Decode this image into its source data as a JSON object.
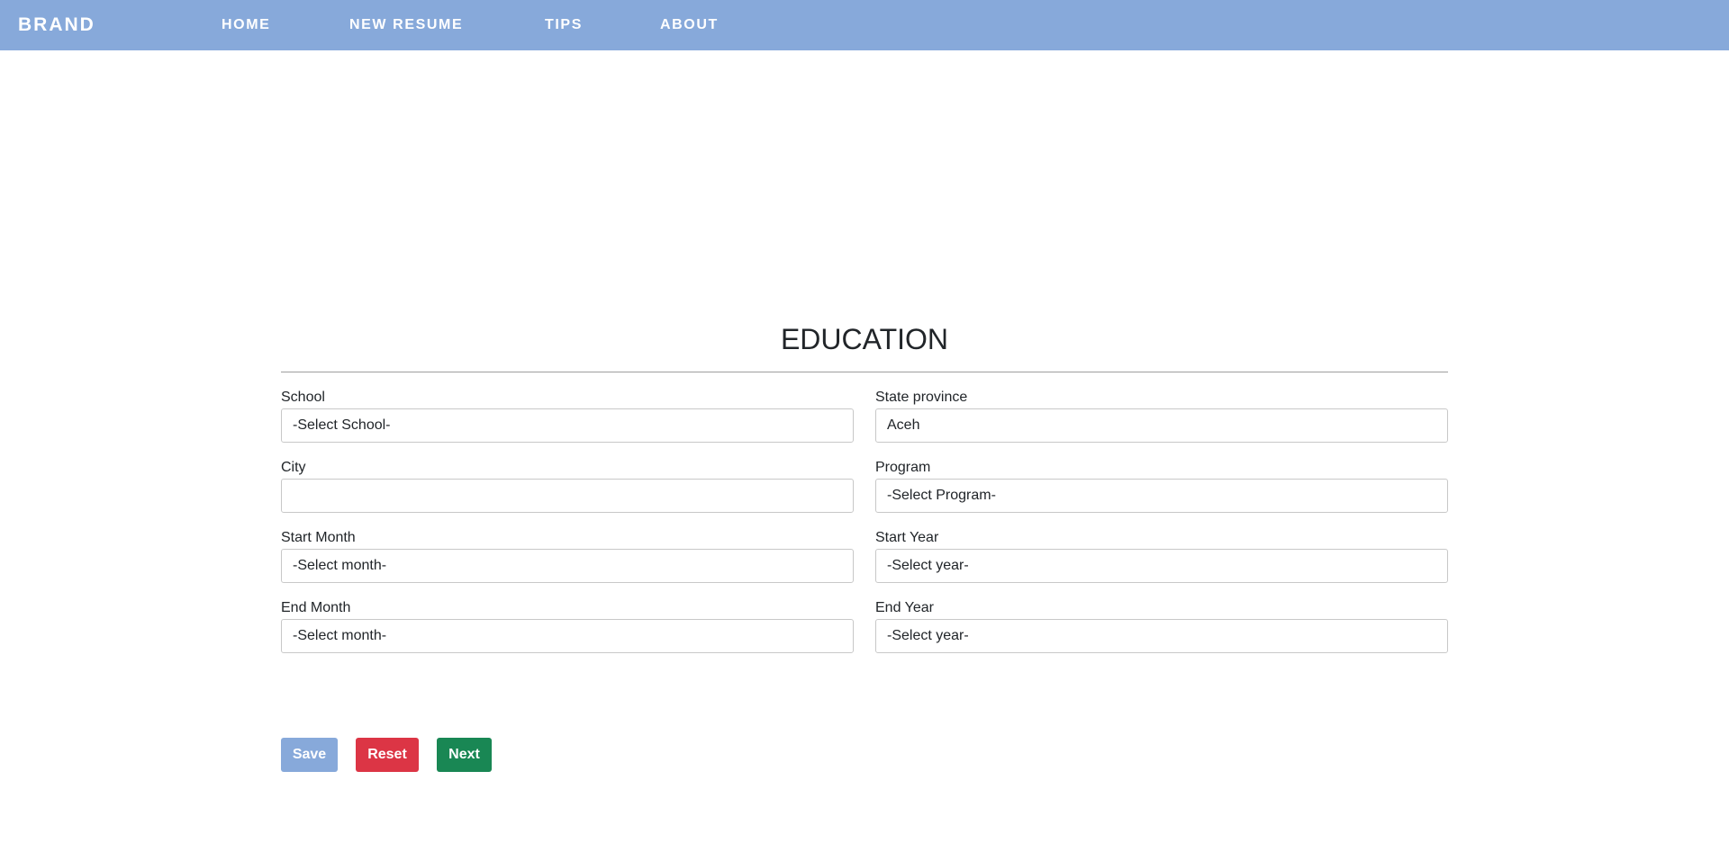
{
  "nav": {
    "brand": "BRAND",
    "links": [
      "HOME",
      "NEW RESUME",
      "TIPS",
      "ABOUT"
    ]
  },
  "form": {
    "title": "EDUCATION",
    "fields": {
      "school": {
        "label": "School",
        "value": "-Select School-"
      },
      "state_province": {
        "label": "State province",
        "value": "Aceh"
      },
      "city": {
        "label": "City",
        "value": ""
      },
      "program": {
        "label": "Program",
        "value": "-Select Program-"
      },
      "start_month": {
        "label": "Start Month",
        "value": "-Select month-"
      },
      "start_year": {
        "label": "Start Year",
        "value": "-Select year-"
      },
      "end_month": {
        "label": "End Month",
        "value": "-Select month-"
      },
      "end_year": {
        "label": "End Year",
        "value": "-Select year-"
      }
    },
    "buttons": {
      "save": "Save",
      "reset": "Reset",
      "next": "Next"
    }
  },
  "colors": {
    "navbar": "#87a9da",
    "save": "#87a9da",
    "reset": "#dc3545",
    "next": "#198754"
  }
}
